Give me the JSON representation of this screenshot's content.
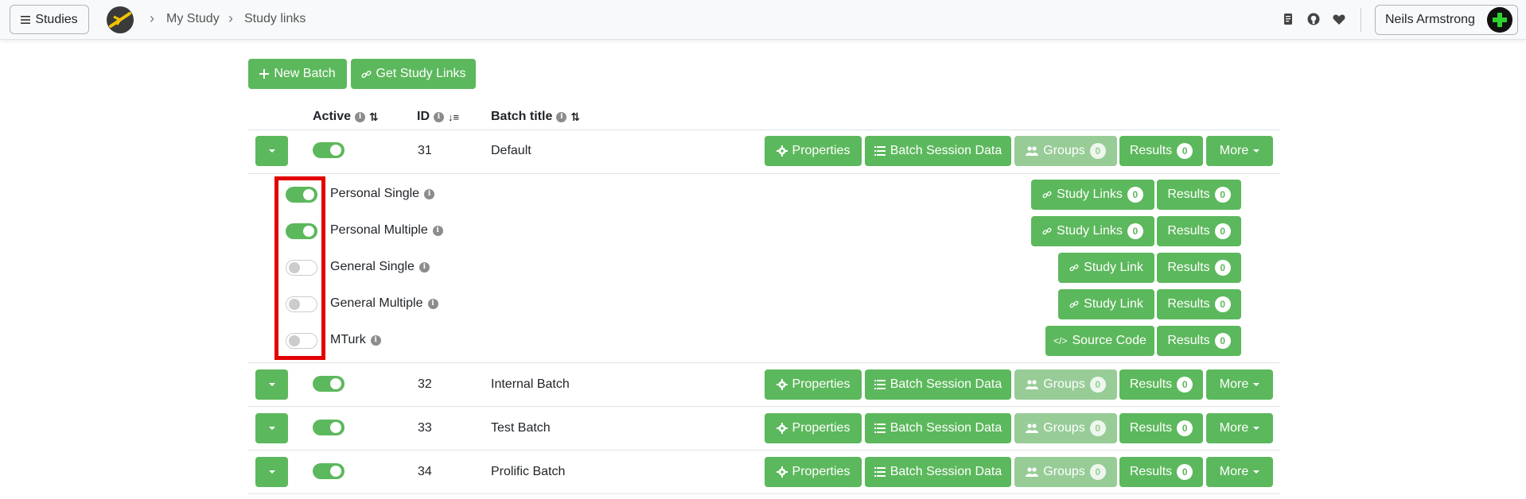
{
  "nav": {
    "studies_label": "Studies",
    "breadcrumb": [
      "My Study",
      "Study links"
    ],
    "user_name": "Neils Armstrong"
  },
  "toolbar": {
    "new_batch": "New Batch",
    "get_study_links": "Get Study Links"
  },
  "table": {
    "headers": {
      "active": "Active",
      "id": "ID",
      "batch_title": "Batch title"
    },
    "buttons": {
      "properties": "Properties",
      "batch_session_data": "Batch Session Data",
      "groups": "Groups",
      "results": "Results",
      "more": "More"
    },
    "batches": [
      {
        "id": "31",
        "title": "Default",
        "active": true,
        "groups_count": "0",
        "results_count": "0"
      },
      {
        "id": "32",
        "title": "Internal Batch",
        "active": true,
        "groups_count": "0",
        "results_count": "0"
      },
      {
        "id": "33",
        "title": "Test Batch",
        "active": true,
        "groups_count": "0",
        "results_count": "0"
      },
      {
        "id": "34",
        "title": "Prolific Batch",
        "active": true,
        "groups_count": "0",
        "results_count": "0"
      }
    ],
    "link_types": [
      {
        "label": "Personal Single",
        "enabled": true,
        "link_button": "Study Links",
        "link_count": "0",
        "results_count": "0"
      },
      {
        "label": "Personal Multiple",
        "enabled": true,
        "link_button": "Study Links",
        "link_count": "0",
        "results_count": "0"
      },
      {
        "label": "General Single",
        "enabled": false,
        "link_button": "Study Link",
        "results_count": "0"
      },
      {
        "label": "General Multiple",
        "enabled": false,
        "link_button": "Study Link",
        "results_count": "0"
      },
      {
        "label": "MTurk",
        "enabled": false,
        "link_button": "Source Code",
        "results_count": "0"
      }
    ],
    "results_label": "Results"
  },
  "colors": {
    "accent": "#5cb85c",
    "accent_light": "#97cc97",
    "highlight": "#e30000"
  }
}
